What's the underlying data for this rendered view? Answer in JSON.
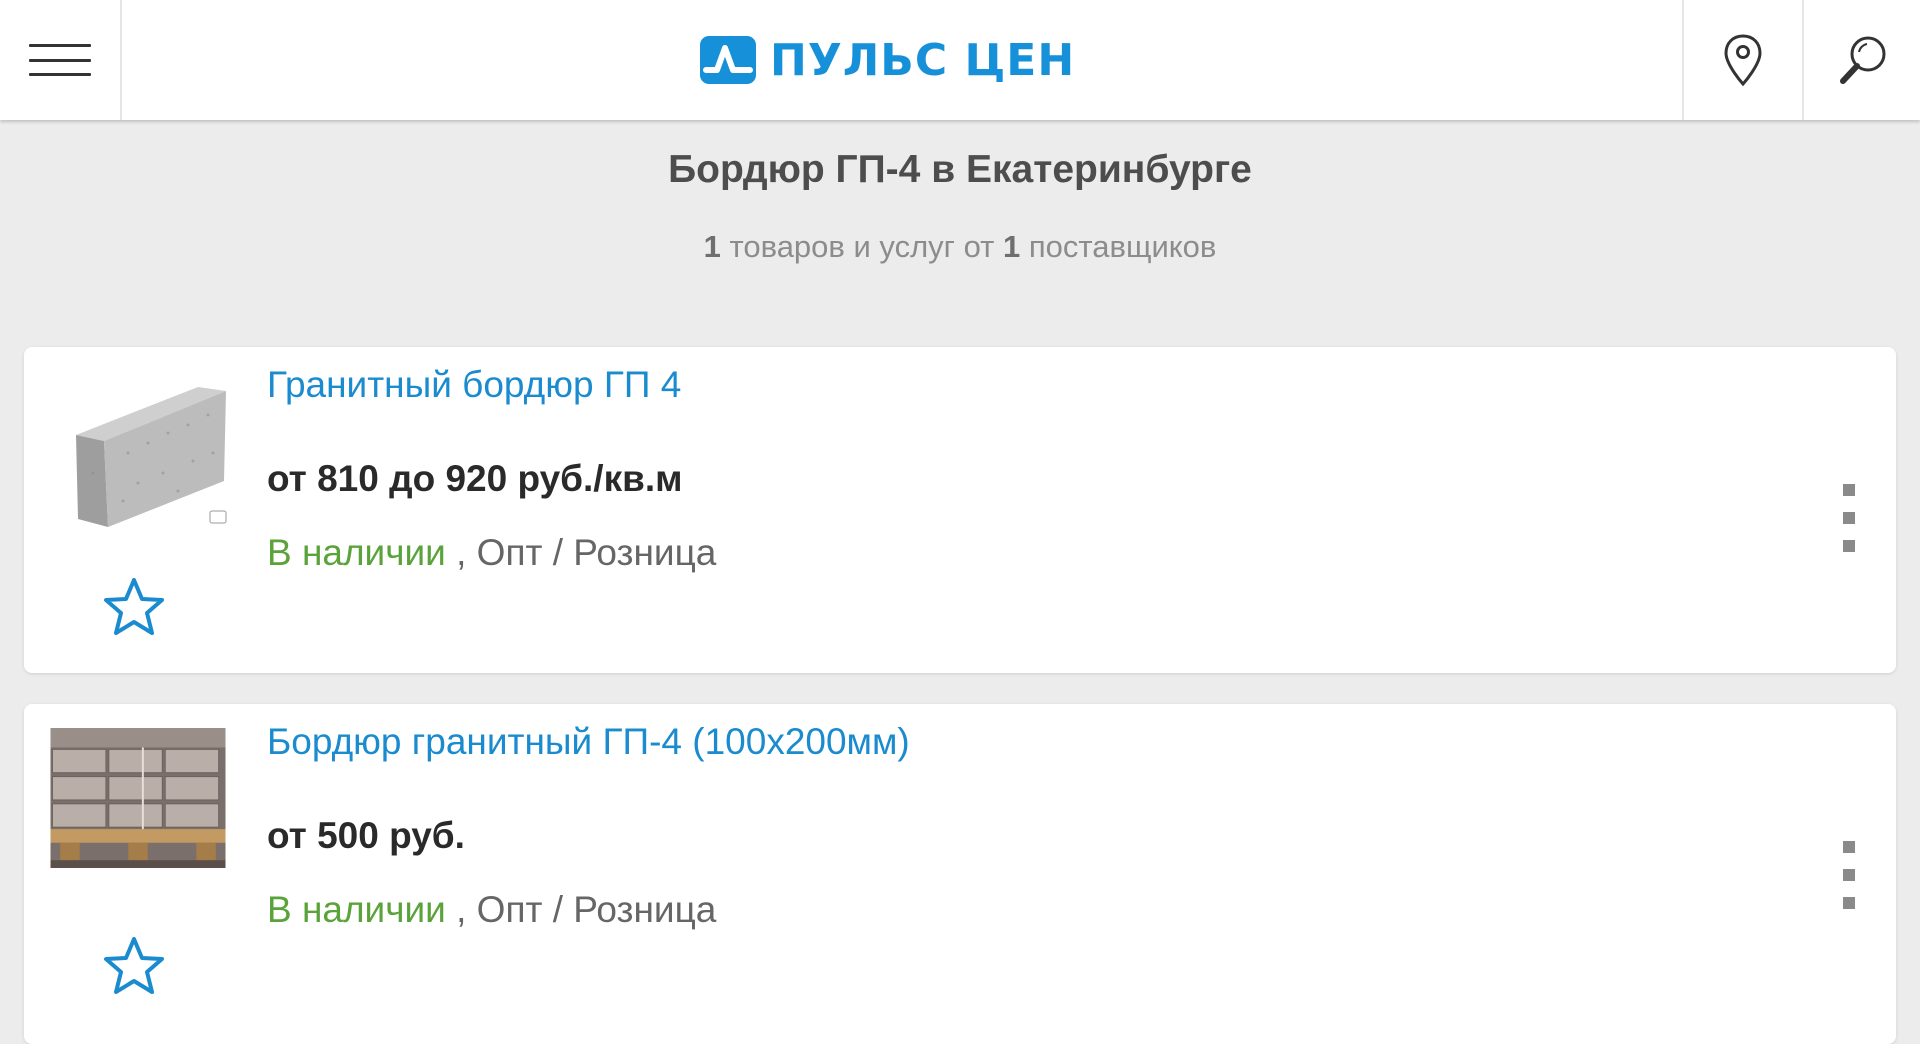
{
  "header": {
    "logo_text": "ПУЛЬС ЦЕН",
    "brand_color": "#1690d8",
    "menu_icon": "hamburger-icon",
    "geo_icon": "location-pin-icon",
    "search_icon": "search-icon"
  },
  "page": {
    "title": "Бордюр ГП-4 в Екатеринбурге",
    "subtitle": {
      "products_count": "1",
      "products_text": "товаров и услуг от",
      "suppliers_count": "1",
      "suppliers_text": "поставщиков"
    }
  },
  "products": [
    {
      "title": "Гранитный бордюр ГП 4",
      "price": "от 810 до 920 руб./кв.м",
      "availability": "В наличии",
      "trade_type": ", Опт / Розница"
    },
    {
      "title": "Бордюр гранитный ГП-4 (100х200мм)",
      "price": "от 500 руб.",
      "availability": "В наличии",
      "trade_type": ", Опт / Розница"
    }
  ],
  "colors": {
    "link": "#1a8bcf",
    "available": "#5aa33a",
    "star": "#1a8bcf"
  }
}
